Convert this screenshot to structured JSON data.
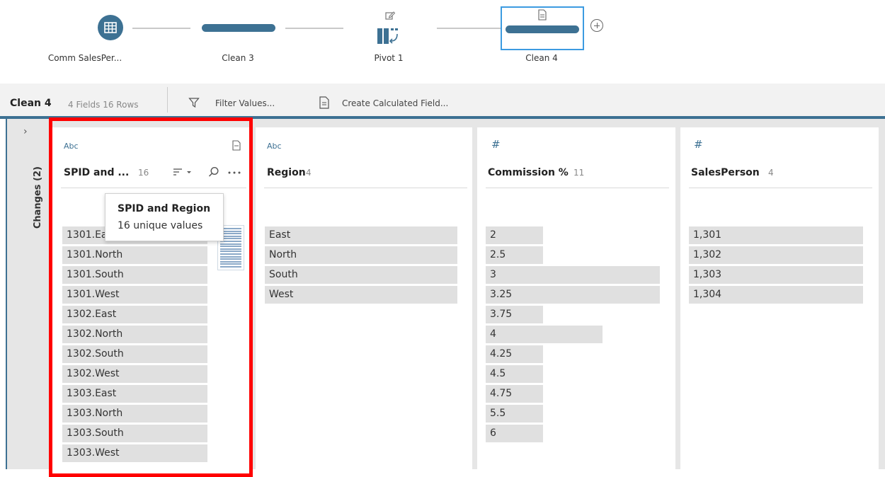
{
  "flow": {
    "nodes": [
      {
        "label": "Comm SalesPer..."
      },
      {
        "label": "Clean 3"
      },
      {
        "label": "Pivot 1"
      },
      {
        "label": "Clean 4"
      }
    ]
  },
  "toolbar": {
    "title": "Clean 4",
    "meta": "4 Fields  16 Rows",
    "filter_label": "Filter Values...",
    "calc_label": "Create Calculated Field..."
  },
  "changes_panel": {
    "label": "Changes (2)"
  },
  "columns": [
    {
      "type": "Abc",
      "name": "SPID and ...",
      "count": "16",
      "values": [
        "1301.East",
        "1301.North",
        "1301.South",
        "1301.West",
        "1302.East",
        "1302.North",
        "1302.South",
        "1302.West",
        "1303.East",
        "1303.North",
        "1303.South",
        "1303.West"
      ],
      "bar_fractions": [
        1,
        1,
        1,
        1,
        1,
        1,
        1,
        1,
        1,
        1,
        1,
        1
      ]
    },
    {
      "type": "Abc",
      "name": "Region",
      "count": "4",
      "values": [
        "East",
        "North",
        "South",
        "West"
      ],
      "bar_fractions": [
        1,
        1,
        1,
        1
      ]
    },
    {
      "type": "#",
      "name": "Commission %",
      "count": "11",
      "values": [
        "2",
        "2.5",
        "3",
        "3.25",
        "3.75",
        "4",
        "4.25",
        "4.5",
        "4.75",
        "5.5",
        "6"
      ],
      "bar_fractions": [
        0.33,
        0.33,
        1,
        1,
        0.33,
        0.67,
        0.33,
        0.33,
        0.33,
        0.33,
        0.33
      ]
    },
    {
      "type": "#",
      "name": "SalesPerson",
      "count": "4",
      "values": [
        "1,301",
        "1,302",
        "1,303",
        "1,304"
      ],
      "bar_fractions": [
        1,
        1,
        1,
        1
      ]
    }
  ],
  "tooltip": {
    "title": "SPID and Region",
    "subtitle": "16 unique values"
  },
  "colors": {
    "accent": "#3d7193",
    "selection": "#3c9be1",
    "highlight": "#ff0000",
    "bar": "#e0e0e0"
  },
  "icons": [
    "table-icon",
    "pivot-icon",
    "edit-icon",
    "clean-step-icon",
    "add-step-icon",
    "filter-icon",
    "calc-field-icon",
    "chevron-right-icon",
    "sort-icon",
    "search-icon",
    "more-icon",
    "field-menu-icon"
  ]
}
